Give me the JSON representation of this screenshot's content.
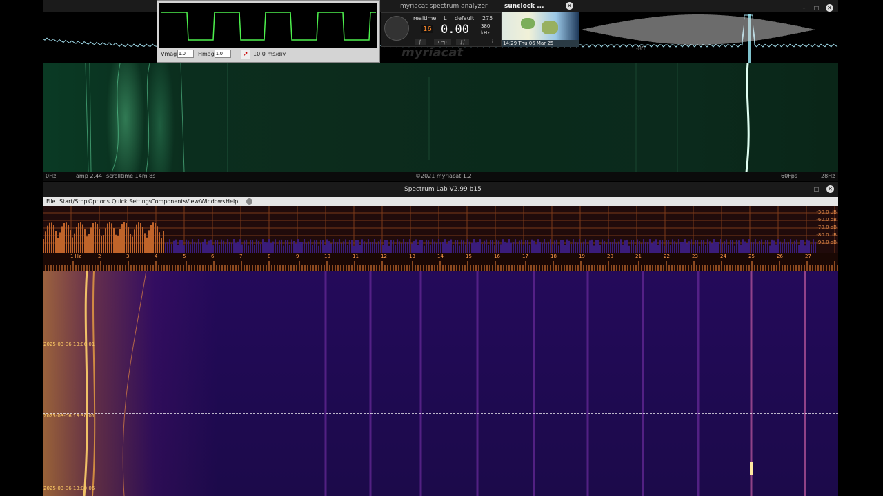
{
  "myriacat": {
    "title": "myriacat spectrum analyzer",
    "status": {
      "left_freq": "0Hz",
      "amp": "amp 2.44",
      "scrolltime": "scrolltime 14m 8s",
      "copyright": "©2021 myriacat 1.2",
      "fps": "60Fps",
      "right_freq": "28Hz"
    },
    "spectrum_label": "-85",
    "logo_text": "myriacat"
  },
  "scope": {
    "vmag_label": "Vmag",
    "vmag_value": "1.0",
    "hmag_label": "Hmag",
    "hmag_value": "1.0",
    "timebase": "10.0 ms/div"
  },
  "control_panel": {
    "mode": "realtime",
    "channel": "L",
    "preset": "default",
    "value_top": "275",
    "small_display": "16",
    "big_display": "0.00",
    "value_mid": "380",
    "unit": "kHz",
    "btn_left": "∫",
    "btn_mid": "cep",
    "btn_right": "∫∫",
    "info": "i"
  },
  "sunclock": {
    "title": "sunclock ...",
    "datetime": "14:29 Thu 06 Mar 25"
  },
  "spectrum_lab": {
    "title": "Spectrum Lab V2.99 b15",
    "menu": [
      "File",
      "Start/Stop",
      "Options",
      "Quick Settings",
      "Components",
      "View/Windows",
      "Help"
    ],
    "db_labels": [
      "-50.0 dB",
      "-60.0 dB",
      "-70.0 dB",
      "-80.0 dB",
      "-90.0 dB"
    ],
    "axis_first": "1 Hz",
    "axis_ticks": [
      "2",
      "3",
      "4",
      "5",
      "6",
      "7",
      "8",
      "9",
      "10",
      "11",
      "12",
      "13",
      "14",
      "15",
      "16",
      "17",
      "18",
      "19",
      "20",
      "21",
      "22",
      "23",
      "24",
      "25",
      "26",
      "27"
    ],
    "timestamps": [
      "2025-03-06 13:00:01",
      "2025-03-06 13:30:01",
      "2025-03-06 13:00:06"
    ]
  },
  "colors": {
    "myriacat_green": "#1f7a4f",
    "spectrum_cyan": "#7fe6ff",
    "spl_orange": "#ffaa33",
    "spl_purple": "#2a0d66"
  }
}
